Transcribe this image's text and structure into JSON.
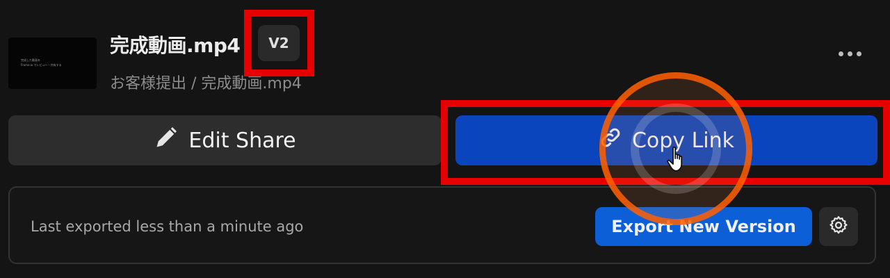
{
  "file": {
    "thumbnail_line1": "完成した動画を",
    "thumbnail_line2": "Frame.io でレビュー・共有する",
    "title": "完成動画.mp4",
    "version": "V2",
    "path": "お客様提出 / 完成動画.mp4",
    "more_icon": "more-horizontal-icon"
  },
  "actions": {
    "edit_share_label": "Edit Share",
    "edit_share_icon": "pencil-icon",
    "copy_link_label": "Copy Link",
    "copy_link_icon": "link-icon"
  },
  "export": {
    "status": "Last exported less than a minute ago",
    "button_label": "Export New Version",
    "settings_icon": "gear-icon"
  },
  "colors": {
    "background": "#141414",
    "primary_button": "#0a45bd",
    "export_button": "#0d5fd8",
    "highlight": "#e60000",
    "click_ring": "#ff5f00"
  }
}
